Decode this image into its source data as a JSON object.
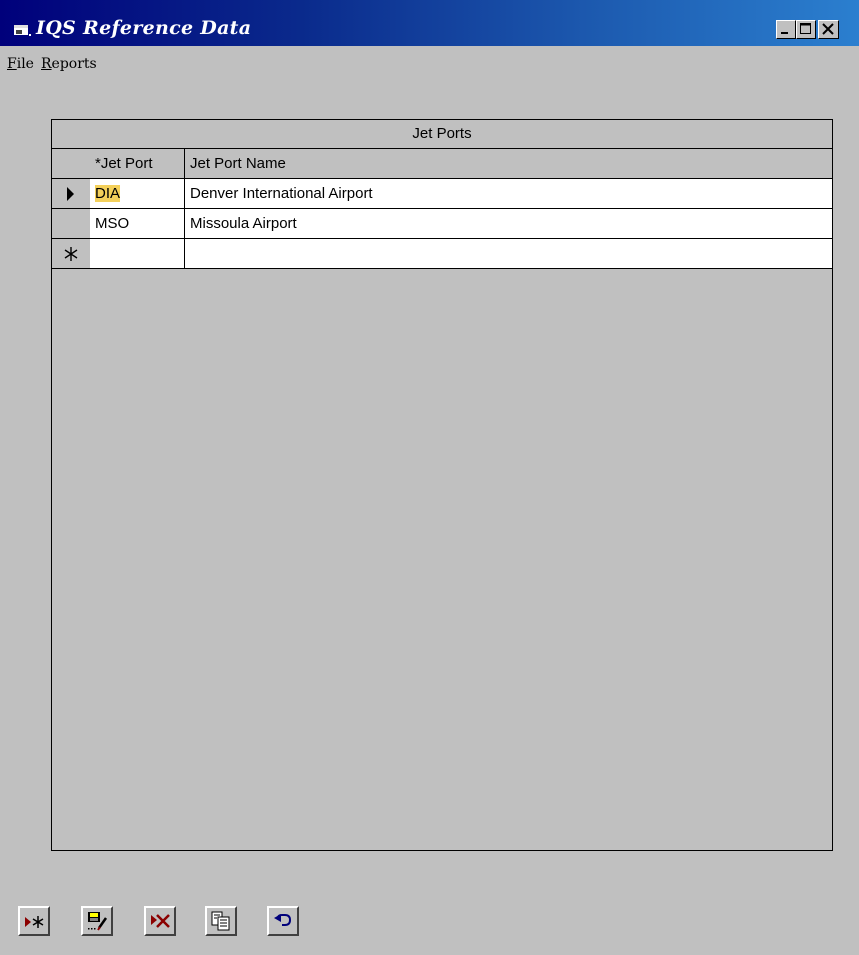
{
  "window": {
    "title": "IQS Reference Data"
  },
  "menu": {
    "file_first": "F",
    "file_rest": "ile",
    "reports_first": "R",
    "reports_rest": "eports"
  },
  "grid": {
    "caption": "Jet Ports",
    "columns": [
      "*Jet Port",
      "Jet Port Name"
    ],
    "rows": [
      {
        "code": "DIA",
        "name": "Denver International Airport",
        "current": true
      },
      {
        "code": "MSO",
        "name": "Missoula Airport",
        "current": false
      }
    ],
    "new_row": {
      "code": "",
      "name": ""
    }
  },
  "toolbar": {
    "icons": [
      "new-record-icon",
      "edit-record-icon",
      "delete-record-icon",
      "copy-record-icon",
      "undo-icon"
    ]
  },
  "colors": {
    "title_gradient_start": "#00007b",
    "title_gradient_end": "#2b7fcf",
    "highlight": "#f4d05a",
    "dark_red": "#8b0000"
  }
}
